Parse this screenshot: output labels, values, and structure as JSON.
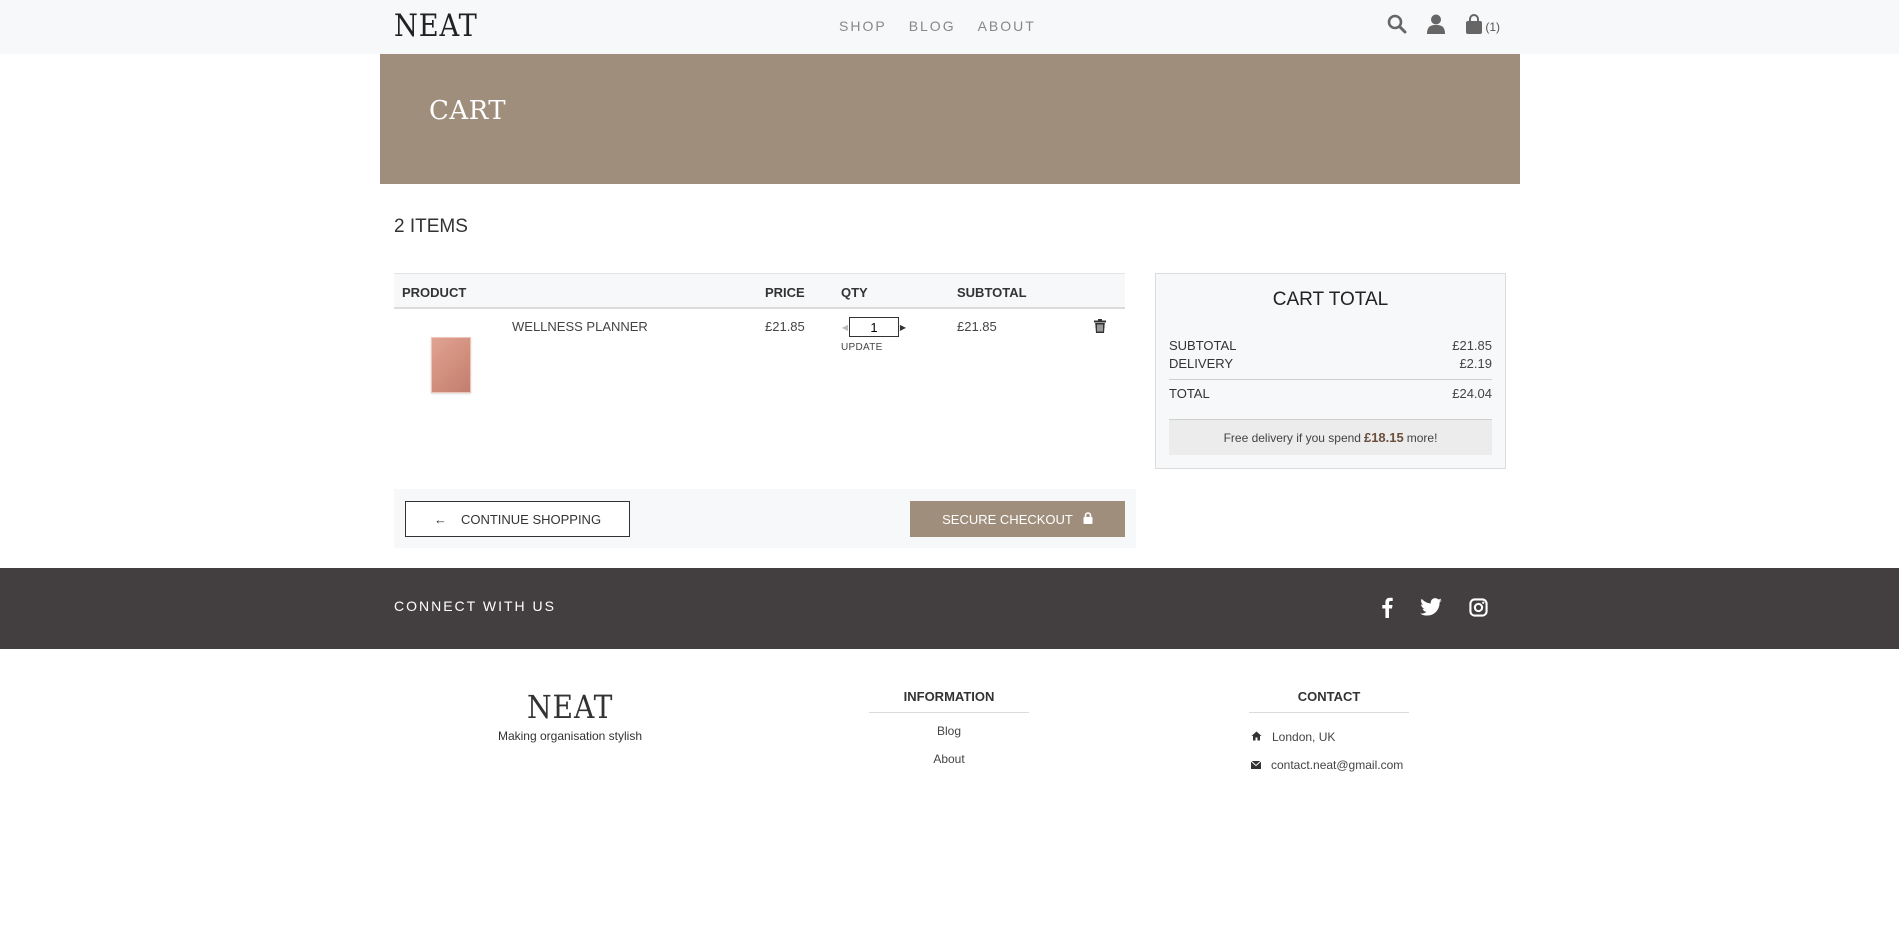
{
  "nav": {
    "logo": "NEAT",
    "links": [
      "SHOP",
      "BLOG",
      "ABOUT"
    ],
    "cart_count": "(1)",
    "icons": [
      "search-icon",
      "user-icon",
      "shopping-bag-icon"
    ]
  },
  "hero": {
    "title": "CART"
  },
  "cart": {
    "items_count": "2 ITEMS",
    "headers": {
      "product": "PRODUCT",
      "price": "PRICE",
      "qty": "QTY",
      "subtotal": "SUBTOTAL"
    },
    "items": [
      {
        "name": "WELLNESS PLANNER",
        "price": "£21.85",
        "qty": "1",
        "update_label": "UPDATE",
        "subtotal": "£21.85"
      }
    ],
    "continue_label": "CONTINUE SHOPPING",
    "continue_arrow": "←",
    "checkout_label": "SECURE CHECKOUT"
  },
  "totals": {
    "title": "CART TOTAL",
    "subtotal_label": "SUBTOTAL",
    "subtotal_value": "£21.85",
    "delivery_label": "DELIVERY",
    "delivery_value": "£2.19",
    "total_label": "TOTAL",
    "total_value": "£24.04",
    "free_prefix": "Free delivery if you spend",
    "free_amount": "£18.15",
    "free_suffix": "more!"
  },
  "connect": {
    "title": "CONNECT WITH US",
    "social": [
      "facebook-icon",
      "twitter-icon",
      "instagram-icon"
    ]
  },
  "footer": {
    "logo": "NEAT",
    "tagline": "Making organisation stylish",
    "info_title": "INFORMATION",
    "info_links": [
      "Blog",
      "About"
    ],
    "contact_title": "CONTACT",
    "location": "London, UK",
    "email": "contact.neat@gmail.com"
  },
  "colors": {
    "accent": "#a08e7d",
    "dark_band": "#433f40",
    "nav_bg": "#f7f8fa"
  }
}
